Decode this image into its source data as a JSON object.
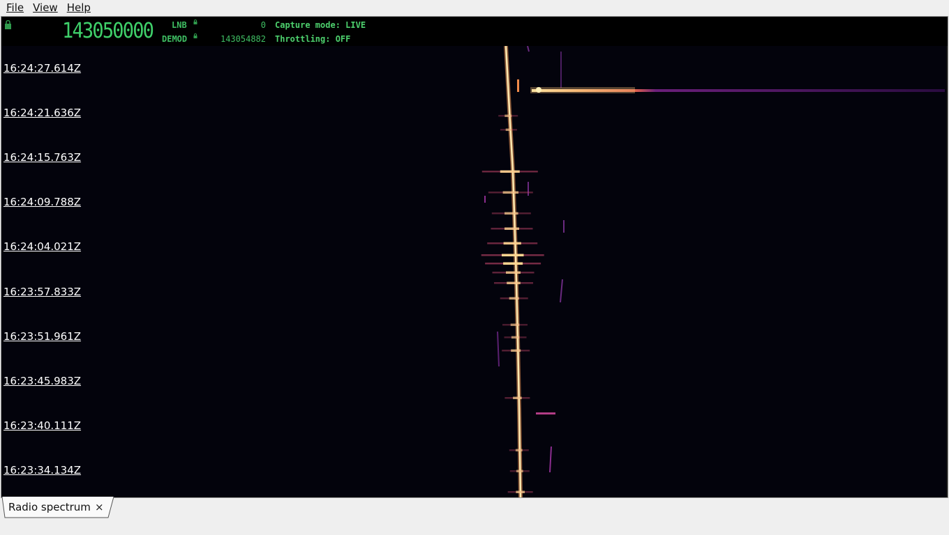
{
  "menubar": {
    "items": [
      {
        "name": "file",
        "label": "File"
      },
      {
        "name": "view",
        "label": "View"
      },
      {
        "name": "help",
        "label": "Help"
      }
    ]
  },
  "header": {
    "main_frequency": "143050000",
    "lnb_label": "LNB",
    "lnb_value": "0",
    "demod_label": "DEMOD",
    "demod_value": "143054882",
    "capture_mode": "Capture mode: LIVE",
    "throttling": "Throttling: OFF"
  },
  "waterfall": {
    "timestamps": [
      "16:24:27.614Z",
      "16:24:21.636Z",
      "16:24:15.763Z",
      "16:24:09.788Z",
      "16:24:04.021Z",
      "16:23:57.833Z",
      "16:23:51.961Z",
      "16:23:45.983Z",
      "16:23:40.111Z",
      "16:23:34.134Z"
    ],
    "colors": {
      "background": "#03030c",
      "hot": "#fff3b0",
      "mid": "#f08a4a",
      "cool": "#8b2d8f"
    }
  },
  "tabs": [
    {
      "label": "Radio spectrum",
      "close": "×"
    }
  ]
}
